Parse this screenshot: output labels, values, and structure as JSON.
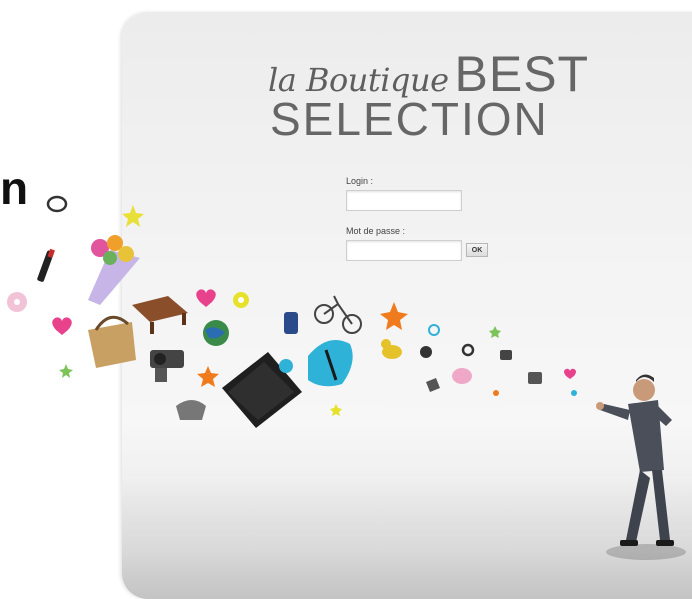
{
  "left_fragment": "n",
  "brand": {
    "script_text": "la Boutique",
    "caps_text": "BEST",
    "line2": "SELECTION"
  },
  "login_form": {
    "login_label": "Login :",
    "login_value": "",
    "password_label": "Mot de passe :",
    "password_value": "",
    "ok_label": "OK"
  },
  "colors": {
    "panel_bg": "#f3f3f3",
    "title_gray": "#666666",
    "accent_pink": "#e8428c",
    "accent_orange": "#f07b1d",
    "accent_yellow": "#e6e22a",
    "accent_cyan": "#2fb2d8"
  }
}
